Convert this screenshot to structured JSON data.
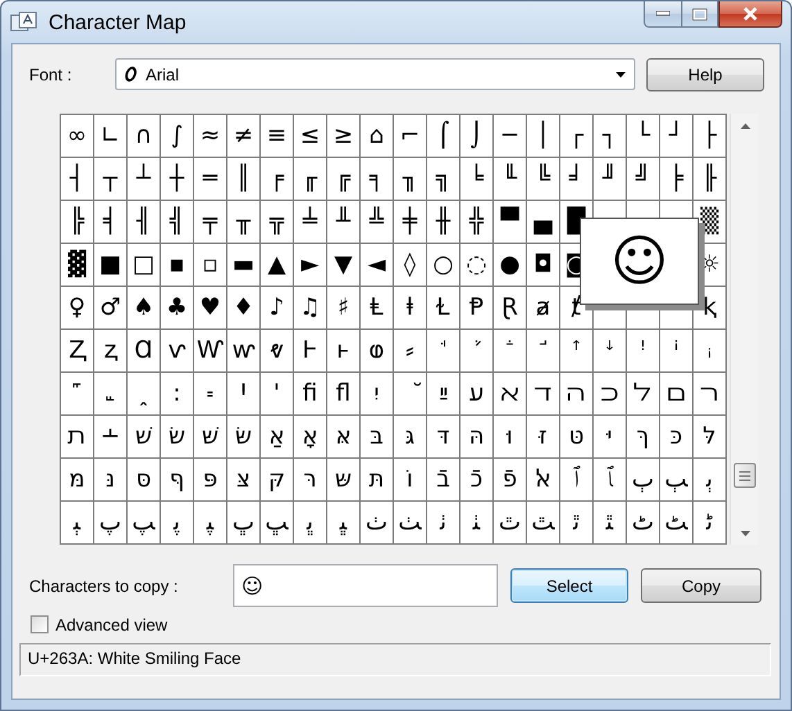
{
  "window": {
    "title": "Character Map"
  },
  "font": {
    "label": "Font :",
    "value": "Arial"
  },
  "help_button": {
    "label": "Help"
  },
  "grid": {
    "rows": [
      [
        "∞",
        "∟",
        "∩",
        "∫",
        "≈",
        "≠",
        "≡",
        "≤",
        "≥",
        "⌂",
        "⌐",
        "⌠",
        "⌡",
        "─",
        "│",
        "┌",
        "┐",
        "└",
        "┘",
        "├"
      ],
      [
        "┤",
        "┬",
        "┴",
        "┼",
        "═",
        "║",
        "╒",
        "╓",
        "╔",
        "╕",
        "╖",
        "╗",
        "╘",
        "╙",
        "╚",
        "╛",
        "╜",
        "╝",
        "╞",
        "╟"
      ],
      [
        "╠",
        "╡",
        "╢",
        "╣",
        "╤",
        "╥",
        "╦",
        "╧",
        "╨",
        "╩",
        "╪",
        "╫",
        "╬",
        "▀",
        "▄",
        "█",
        null,
        null,
        null,
        "▒"
      ],
      [
        "▓",
        "■",
        "□",
        "▪",
        "▫",
        "▬",
        "▲",
        "►",
        "▼",
        "◄",
        "◊",
        "○",
        "◌",
        "●",
        "◘",
        "◙",
        null,
        null,
        null,
        "☼"
      ],
      [
        "♀",
        "♂",
        "♠",
        "♣",
        "♥",
        "♦",
        "♪",
        "♫",
        "♯",
        "Ⱡ",
        "ⱡ",
        "Ɫ",
        "Ᵽ",
        "Ɽ",
        "ⱥ",
        "ⱦ",
        null,
        null,
        null,
        "ⱪ"
      ],
      [
        "Ⱬ",
        "ⱬ",
        "Ɑ",
        "ⱱ",
        "Ⱳ",
        "ⱳ",
        "ⱴ",
        "Ⱶ",
        "ⱶ",
        "ⱷ",
        "⸗",
        "ꜗ",
        "ꜘ",
        "ꜙ",
        "ꜚ",
        "ꜛ",
        "ꜜ",
        "ꜝ",
        "ꜞ",
        "ꜟ"
      ],
      [
        "꜠",
        "꜡",
        "ꞈ",
        "꞉",
        "꞊",
        "Ꞌ",
        "ꞌ",
        "ﬁ",
        "ﬂ",
        "יִ",
        "ﬞ",
        "ײַ",
        "ﬠ",
        "ﬡ",
        "ﬢ",
        "ﬣ",
        "ﬤ",
        "ﬥ",
        "ﬦ",
        "ﬧ"
      ],
      [
        "ﬨ",
        "﬩",
        "שׁ",
        "שׂ",
        "שּׁ",
        "שּׂ",
        "אַ",
        "אָ",
        "אּ",
        "בּ",
        "גּ",
        "דּ",
        "הּ",
        "וּ",
        "זּ",
        "טּ",
        "יּ",
        "ךּ",
        "כּ",
        "לּ"
      ],
      [
        "מּ",
        "נּ",
        "סּ",
        "ףּ",
        "פּ",
        "צּ",
        "קּ",
        "רּ",
        "שּ",
        "תּ",
        "וֹ",
        "בֿ",
        "כֿ",
        "פֿ",
        "ﭏ",
        "ﭐ",
        "ﭑ",
        "ﭒ",
        "ﭓ",
        "ﭔ"
      ],
      [
        "ﭕ",
        "ﭖ",
        "ﭗ",
        "ﭘ",
        "ﭙ",
        "ﭚ",
        "ﭛ",
        "ﭜ",
        "ﭝ",
        "ﭞ",
        "ﭟ",
        "ﭠ",
        "ﭡ",
        "ﭢ",
        "ﭣ",
        "ﭤ",
        "ﭥ",
        "ﭦ",
        "ﭧ",
        "ﭨ"
      ]
    ],
    "magnified": "☺"
  },
  "copy": {
    "label": "Characters to copy :",
    "value": "☺"
  },
  "buttons": [
    {
      "label": "Select",
      "focused": true
    },
    {
      "label": "Copy",
      "focused": false
    }
  ],
  "advanced_view": {
    "label": "Advanced view",
    "checked": false
  },
  "status_bar": "U+263A: White Smiling Face"
}
